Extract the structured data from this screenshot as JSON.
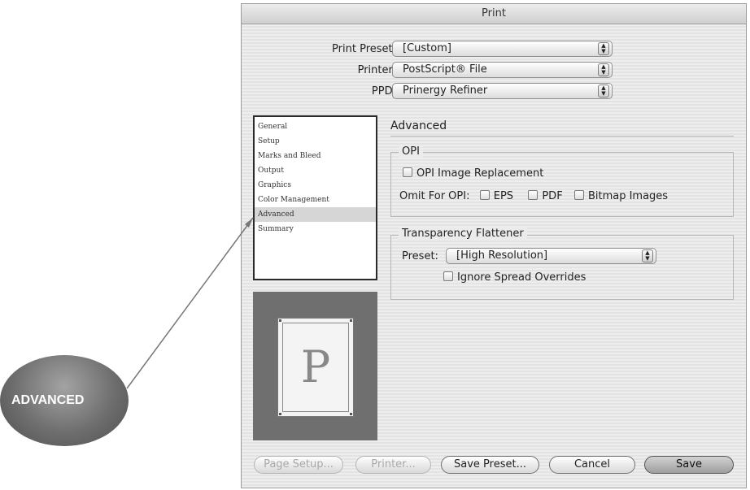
{
  "window": {
    "title": "Print"
  },
  "header": {
    "preset_label": "Print Preset:",
    "preset_value": "[Custom]",
    "printer_label": "Printer:",
    "printer_value": "PostScript® File",
    "ppd_label": "PPD:",
    "ppd_value": "Prinergy Refiner"
  },
  "sidebar": {
    "items": [
      {
        "label": "General"
      },
      {
        "label": "Setup"
      },
      {
        "label": "Marks and Bleed"
      },
      {
        "label": "Output"
      },
      {
        "label": "Graphics"
      },
      {
        "label": "Color Management"
      },
      {
        "label": "Advanced",
        "selected": true
      },
      {
        "label": "Summary"
      }
    ]
  },
  "preview": {
    "glyph": "P"
  },
  "panel": {
    "title": "Advanced",
    "opi": {
      "group_label": "OPI",
      "image_replacement_label": "OPI Image Replacement",
      "image_replacement_checked": false,
      "omit_label": "Omit For OPI:",
      "omit_eps_label": "EPS",
      "omit_pdf_label": "PDF",
      "omit_bitmap_label": "Bitmap Images"
    },
    "flattener": {
      "group_label": "Transparency Flattener",
      "preset_label": "Preset:",
      "preset_value": "[High Resolution]",
      "ignore_overrides_label": "Ignore Spread Overrides"
    }
  },
  "footer": {
    "page_setup_label": "Page Setup...",
    "printer_label": "Printer...",
    "save_preset_label": "Save Preset...",
    "cancel_label": "Cancel",
    "save_label": "Save"
  },
  "callout": {
    "label": "ADVANCED"
  }
}
